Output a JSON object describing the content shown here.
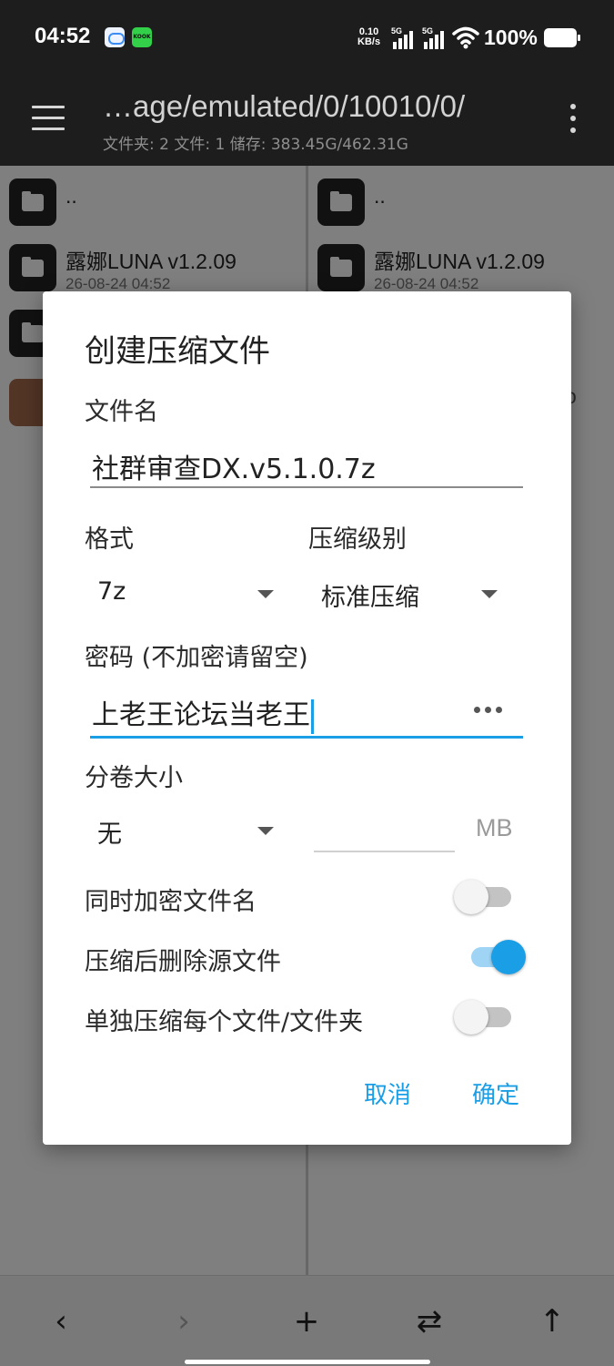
{
  "status_bar": {
    "time": "04:52",
    "app_badge": "KOOK",
    "net_speed_value": "0.10",
    "net_speed_unit": "KB/s",
    "sim1": "5G",
    "sim2": "5G",
    "battery": "100%",
    "icons": [
      "cloud-app-icon",
      "kook-app-icon",
      "signal-icon",
      "wifi-icon",
      "battery-icon"
    ]
  },
  "toolbar": {
    "path": "…age/emulated/0/10010/0/",
    "stats": "文件夹: 2  文件: 1  储存: 383.45G/462.31G"
  },
  "left_pane": {
    "items": [
      {
        "name": "..",
        "date": ""
      },
      {
        "name": "露娜LUNA v1.2.09",
        "date": "26-08-24 04:52"
      }
    ]
  },
  "right_pane": {
    "items": [
      {
        "name": "..",
        "date": ""
      },
      {
        "name": "露娜LUNA v1.2.09",
        "date": "26-08-24 04:52"
      }
    ],
    "partial_text": "o"
  },
  "dialog": {
    "title": "创建压缩文件",
    "filename_label": "文件名",
    "filename_value": "社群审查DX.v5.1.0.7z",
    "format_label": "格式",
    "format_value": "7z",
    "level_label": "压缩级别",
    "level_value": "标准压缩",
    "password_label": "密码 (不加密请留空)",
    "password_value": "上老王论坛当老王",
    "split_label": "分卷大小",
    "split_value": "无",
    "split_unit": "MB",
    "options": [
      {
        "label": "同时加密文件名",
        "on": false
      },
      {
        "label": "压缩后删除源文件",
        "on": true
      },
      {
        "label": "单独压缩每个文件/文件夹",
        "on": false
      }
    ],
    "cancel": "取消",
    "ok": "确定"
  },
  "bottom_bar": {
    "back": "‹",
    "forward": "›",
    "add": "+",
    "swap": "⇄",
    "up": "↑"
  },
  "colors": {
    "accent": "#1a9ee6",
    "dark_bar": "#1d1d1d"
  }
}
